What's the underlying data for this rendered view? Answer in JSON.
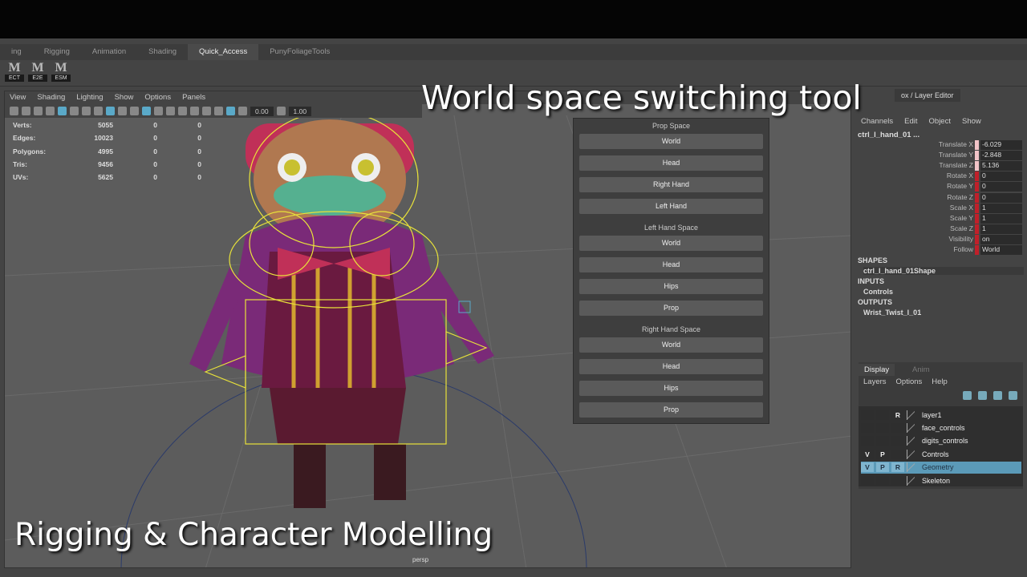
{
  "tabs": [
    "ing",
    "Rigging",
    "Animation",
    "Shading",
    "Quick_Access",
    "PunyFoliageTools"
  ],
  "active_tab": "Quick_Access",
  "shelf": [
    "ECT",
    "E2E",
    "ESM"
  ],
  "viewport": {
    "menu": [
      "View",
      "Shading",
      "Lighting",
      "Show",
      "Options",
      "Panels"
    ],
    "field1": "0.00",
    "field2": "1.00",
    "camera": "persp",
    "stats": [
      [
        "Verts:",
        "5055",
        "0",
        "0"
      ],
      [
        "Edges:",
        "10023",
        "0",
        "0"
      ],
      [
        "Polygons:",
        "4995",
        "0",
        "0"
      ],
      [
        "Tris:",
        "9456",
        "0",
        "0"
      ],
      [
        "UVs:",
        "5625",
        "0",
        "0"
      ]
    ]
  },
  "space_tool": {
    "sections": [
      {
        "label": "Prop Space",
        "buttons": [
          "World",
          "Head",
          "Right Hand",
          "Left Hand"
        ]
      },
      {
        "label": "Left Hand Space",
        "buttons": [
          "World",
          "Head",
          "Hips",
          "Prop"
        ]
      },
      {
        "label": "Right Hand Space",
        "buttons": [
          "World",
          "Head",
          "Hips",
          "Prop"
        ]
      }
    ]
  },
  "channel_box": {
    "title": "ox / Layer Editor",
    "menu": [
      "Channels",
      "Edit",
      "Object",
      "Show"
    ],
    "object": "ctrl_l_hand_01 ...",
    "channels": [
      [
        "Translate X",
        "-6.029"
      ],
      [
        "Translate Y",
        "-2.848"
      ],
      [
        "Translate Z",
        "5.136"
      ],
      [
        "Rotate X",
        "0"
      ],
      [
        "Rotate Y",
        "0"
      ],
      [
        "Rotate Z",
        "0"
      ],
      [
        "Scale X",
        "1"
      ],
      [
        "Scale Y",
        "1"
      ],
      [
        "Scale Z",
        "1"
      ],
      [
        "Visibility",
        "on"
      ],
      [
        "Follow",
        "World"
      ]
    ],
    "shapes_label": "SHAPES",
    "shape": "ctrl_l_hand_01Shape",
    "inputs_label": "INPUTS",
    "input": "Controls",
    "outputs_label": "OUTPUTS",
    "output": "Wrist_Twist_l_01"
  },
  "layer_editor": {
    "tabs": [
      "Display",
      "Anim"
    ],
    "menu": [
      "Layers",
      "Options",
      "Help"
    ],
    "layers": [
      {
        "v": "",
        "p": "",
        "r": "R",
        "name": "layer1"
      },
      {
        "v": "",
        "p": "",
        "r": "",
        "name": "face_controls"
      },
      {
        "v": "",
        "p": "",
        "r": "",
        "name": "digits_controls"
      },
      {
        "v": "V",
        "p": "P",
        "r": "",
        "name": "Controls"
      },
      {
        "v": "V",
        "p": "P",
        "r": "R",
        "name": "Geometry",
        "selected": true
      },
      {
        "v": "",
        "p": "",
        "r": "",
        "name": "Skeleton"
      }
    ]
  },
  "captions": {
    "title": "World space switching tool",
    "subtitle": "Rigging & Character Modelling"
  },
  "colors": {
    "selection": "#5b9ab8",
    "rig_controls": "#e8e23a",
    "keyed_channel": "#c0202a"
  }
}
